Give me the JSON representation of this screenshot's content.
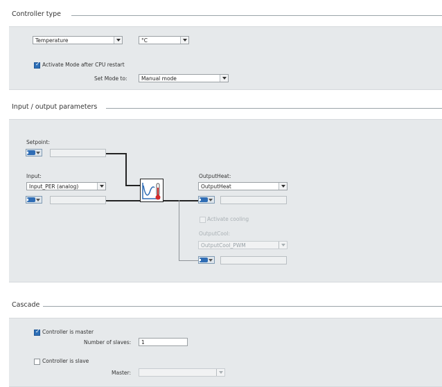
{
  "controller_type": {
    "title": "Controller type",
    "type_select": "Temperature",
    "unit_select": "°C",
    "activate_mode_label": "Activate Mode after CPU restart",
    "activate_mode_checked": true,
    "set_mode_label": "Set Mode to:",
    "set_mode_select": "Manual mode"
  },
  "io_params": {
    "title": "Input / output parameters",
    "setpoint_label": "Setpoint:",
    "input_label": "Input:",
    "input_select": "Input_PER (analog)",
    "output_heat_label": "OutputHeat:",
    "output_heat_select": "OutputHeat",
    "activate_cooling_label": "Activate cooling",
    "activate_cooling_checked": false,
    "output_cool_label": "OutputCool:",
    "output_cool_select": "OutputCool_PWM"
  },
  "cascade": {
    "title": "Cascade",
    "master_label": "Controller is master",
    "master_checked": true,
    "num_slaves_label": "Number of slaves:",
    "num_slaves_value": "1",
    "slave_label": "Controller is slave",
    "slave_checked": false,
    "master_select_label": "Master:",
    "master_select": ""
  },
  "colors": {
    "panel": "#e6e9eb",
    "accent": "#2d6fb7",
    "thermometer_red": "#d42a2a"
  }
}
